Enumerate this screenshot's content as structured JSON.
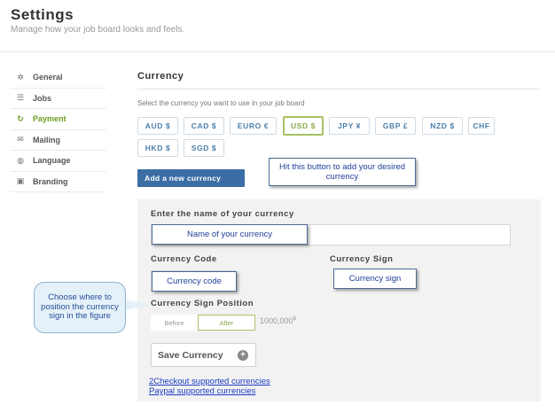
{
  "header": {
    "title": "Settings",
    "subtitle": "Manage how your job board looks and feels."
  },
  "sidebar": {
    "items": [
      {
        "label": "General",
        "icon": "gear-icon",
        "active": false
      },
      {
        "label": "Jobs",
        "icon": "list-icon",
        "active": false
      },
      {
        "label": "Payment",
        "icon": "refresh-icon",
        "active": true
      },
      {
        "label": "Mailing",
        "icon": "mail-icon",
        "active": false
      },
      {
        "label": "Language",
        "icon": "globe-icon",
        "active": false
      },
      {
        "label": "Branding",
        "icon": "box-icon",
        "active": false
      }
    ]
  },
  "main": {
    "section_title": "Currency",
    "description": "Select the currency you want to use in your job board",
    "currencies": [
      {
        "label": "AUD  $",
        "selected": false
      },
      {
        "label": "CAD  $",
        "selected": false
      },
      {
        "label": "EURO  €",
        "selected": false
      },
      {
        "label": "USD  $",
        "selected": true
      },
      {
        "label": "JPY  ¥",
        "selected": false
      },
      {
        "label": "GBP  £",
        "selected": false
      },
      {
        "label": "NZD  $",
        "selected": false
      },
      {
        "label": "CHF",
        "selected": false
      },
      {
        "label": "HKD  $",
        "selected": false
      },
      {
        "label": "SGD  $",
        "selected": false
      }
    ],
    "add_button": "Add a new currency",
    "form": {
      "name_label": "Enter the name of your currency",
      "code_label": "Currency Code",
      "sign_label": "Currency Sign",
      "position_label": "Currency Sign Position",
      "position_before": "Before",
      "position_after": "After",
      "example_value": "1000,000",
      "example_sign": "$",
      "save_button": "Save Currency",
      "link_2checkout": "2Checkout supported currencies",
      "link_paypal": "Paypal supported currencies"
    }
  },
  "annotations": {
    "add_button_hint": "Hit this button to add your desired currency",
    "name_hint": "Name of your currency",
    "code_hint": "Currency code",
    "sign_hint": "Currency sign",
    "position_hint": "Choose where to position the currency sign in the figure"
  },
  "colors": {
    "accent_green": "#8aa84d",
    "primary_blue": "#3b6ea5",
    "link_blue": "#1a3cc4"
  }
}
